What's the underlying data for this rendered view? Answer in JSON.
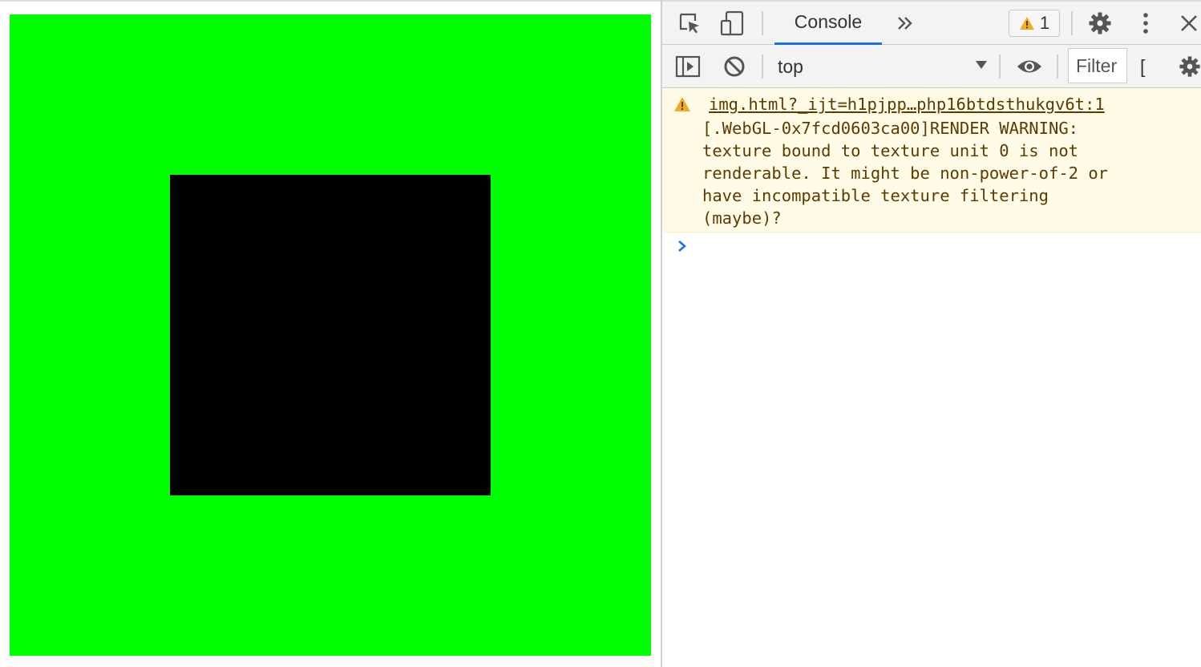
{
  "page": {
    "canvas_color": "#00ff00",
    "quad_color": "#000000"
  },
  "devtools": {
    "tabs": {
      "active_label": "Console"
    },
    "warning_badge": {
      "count": "1"
    },
    "toolbar": {
      "context_label": "top",
      "filter_placeholder": "Filter",
      "levels_label": "["
    },
    "console": {
      "warning": {
        "source": "img.html?_ijt=h1pjpp…php16btdsthukgv6t:1",
        "text": "[.WebGL-0x7fcd0603ca00]RENDER WARNING:\ntexture bound to texture unit 0 is not\nrenderable. It might be non-power-of-2 or\nhave incompatible texture filtering\n(maybe)?"
      },
      "prompt_symbol": "›"
    },
    "icons": {
      "inspect": "inspect-element-icon",
      "device": "device-toolbar-icon",
      "more_tabs": "chevron-double-right-icon",
      "settings": "gear-icon",
      "kebab": "kebab-menu-icon",
      "close": "close-icon",
      "sidebar": "sidebar-toggle-icon",
      "clear": "clear-console-icon",
      "eye": "live-expression-eye-icon",
      "warning": "warning-triangle-icon"
    },
    "colors": {
      "accent": "#1a73e8",
      "warning_bg": "#fffbe6",
      "warning_text": "#5c3b00",
      "warning_icon": "#f2ab26"
    }
  }
}
